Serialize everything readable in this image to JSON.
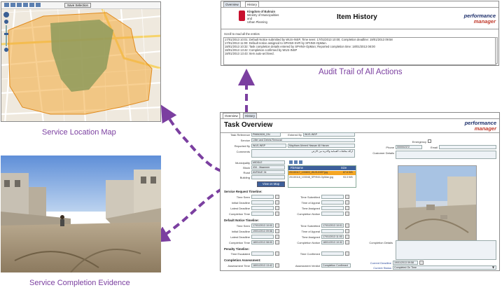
{
  "captions": {
    "map": "Service Location Map",
    "evidence": "Service Completion Evidence",
    "audit": "Audit Trail of All Actions"
  },
  "map": {
    "toolbar_button": "Save Selection"
  },
  "history": {
    "tabs": [
      "Overview",
      "History"
    ],
    "ministry": [
      "Kingdom of Bahrain",
      "Ministry of Municipalities",
      "and",
      "Urban Planning"
    ],
    "title": "Item History",
    "logo": [
      "performance",
      "manager"
    ],
    "scroll_note": "Scroll to read all the entries",
    "entries": [
      "17/01/2013 10:01: Default Notice submitted by WUS-INSP, Time seen: 17/01/2013 10:00; Completion deadline: 19/01/2013 09:58",
      "17/01/2013 11:00: Default notice assigned to SPHNX-SVR by SPHNX-OpMan.",
      "18/01/2013 10:32: Task completion details entered by SPHNX-OpMan; Reported completion time: 18/01/2013 08:00",
      "18/01/2013 13:42: Completion confirmed by WUS-INSP",
      "18/01/2013 13:43: Item auto-archived."
    ]
  },
  "task": {
    "tabs": [
      "Overview",
      "History"
    ],
    "title": "Task Overview",
    "logo": [
      "performance",
      "manager"
    ],
    "labels": {
      "task_ref": "Task Reference",
      "entered_by": "Entered By",
      "service": "Service",
      "reported_by": "Reported By",
      "comments": "Comments",
      "emergency": "Emergency",
      "phone": "Phone",
      "email": "Email",
      "customer_details": "Customer Details",
      "municipality": "Municipality",
      "block": "Block",
      "road": "Road",
      "building": "Building",
      "view_map": "View on Map",
      "completion_details": "Completion Details",
      "current_deadline": "Current Deadline",
      "current_status": "Current Status"
    },
    "values": {
      "task_ref": "PM842626_DN",
      "entered_by": "WUS-INSP",
      "service": "Litter and Debris Removal",
      "reported_by": "WUS-INSP",
      "reporter_name": "Maytham Ahmed Hassan Ali Haram",
      "comments": "ازالة مخلفات القمامة والاتربة من الارض",
      "phone": "000002372",
      "municipality": "MIDDLE",
      "block": "434 - Maameer",
      "road": "AVENUE 34",
      "current_deadline": "19/01/2013 09:58",
      "current_status": "Completed On Time"
    },
    "files": {
      "header": [
        "FileName",
        "Size"
      ],
      "rows": [
        {
          "name": "20130117_100803_WUS-INSP.jpg",
          "size": "87.6 KiB"
        },
        {
          "name": "20130118_103048_SPHNX-OpMan.jpg",
          "size": "93.3 KiB"
        }
      ]
    },
    "sections": {
      "request": "Service Request Timeline:",
      "default": "Default Notice Timeline:",
      "penalty": "Penalty Timeline:",
      "assessment": "Completion Assessment:"
    },
    "request_timeline": {
      "left": [
        "Time Seen",
        "Initial Deadline",
        "Latest Deadline",
        "Completion Time"
      ],
      "right": [
        "Time Submitted",
        "Time of Appeal",
        "Time Assigned",
        "Completion Notice"
      ]
    },
    "default_timeline": {
      "left": [
        {
          "label": "Time Seen",
          "value": "17/01/2013 10:00"
        },
        {
          "label": "Initial Deadline",
          "value": "19/01/2013 09:58"
        },
        {
          "label": "Latest Deadline",
          "value": ""
        },
        {
          "label": "Completion Time",
          "value": "18/01/2013 08:00"
        }
      ],
      "right": [
        {
          "label": "Time Submitted",
          "value": "17/01/2013 10:01"
        },
        {
          "label": "Time of Appeal",
          "value": ""
        },
        {
          "label": "Time Assigned",
          "value": "17/01/2013 11:00"
        },
        {
          "label": "Completion Notice",
          "value": "18/01/2013 10:32"
        }
      ]
    },
    "penalty_timeline": {
      "left": "Time Escalated",
      "right": "Time Confirmed"
    },
    "assessment": {
      "time_label": "Assessment Time",
      "time_value": "18/01/2013 13:42",
      "verdict_label": "Assessment Verdict",
      "verdict_value": "Completion Confirmed"
    }
  }
}
